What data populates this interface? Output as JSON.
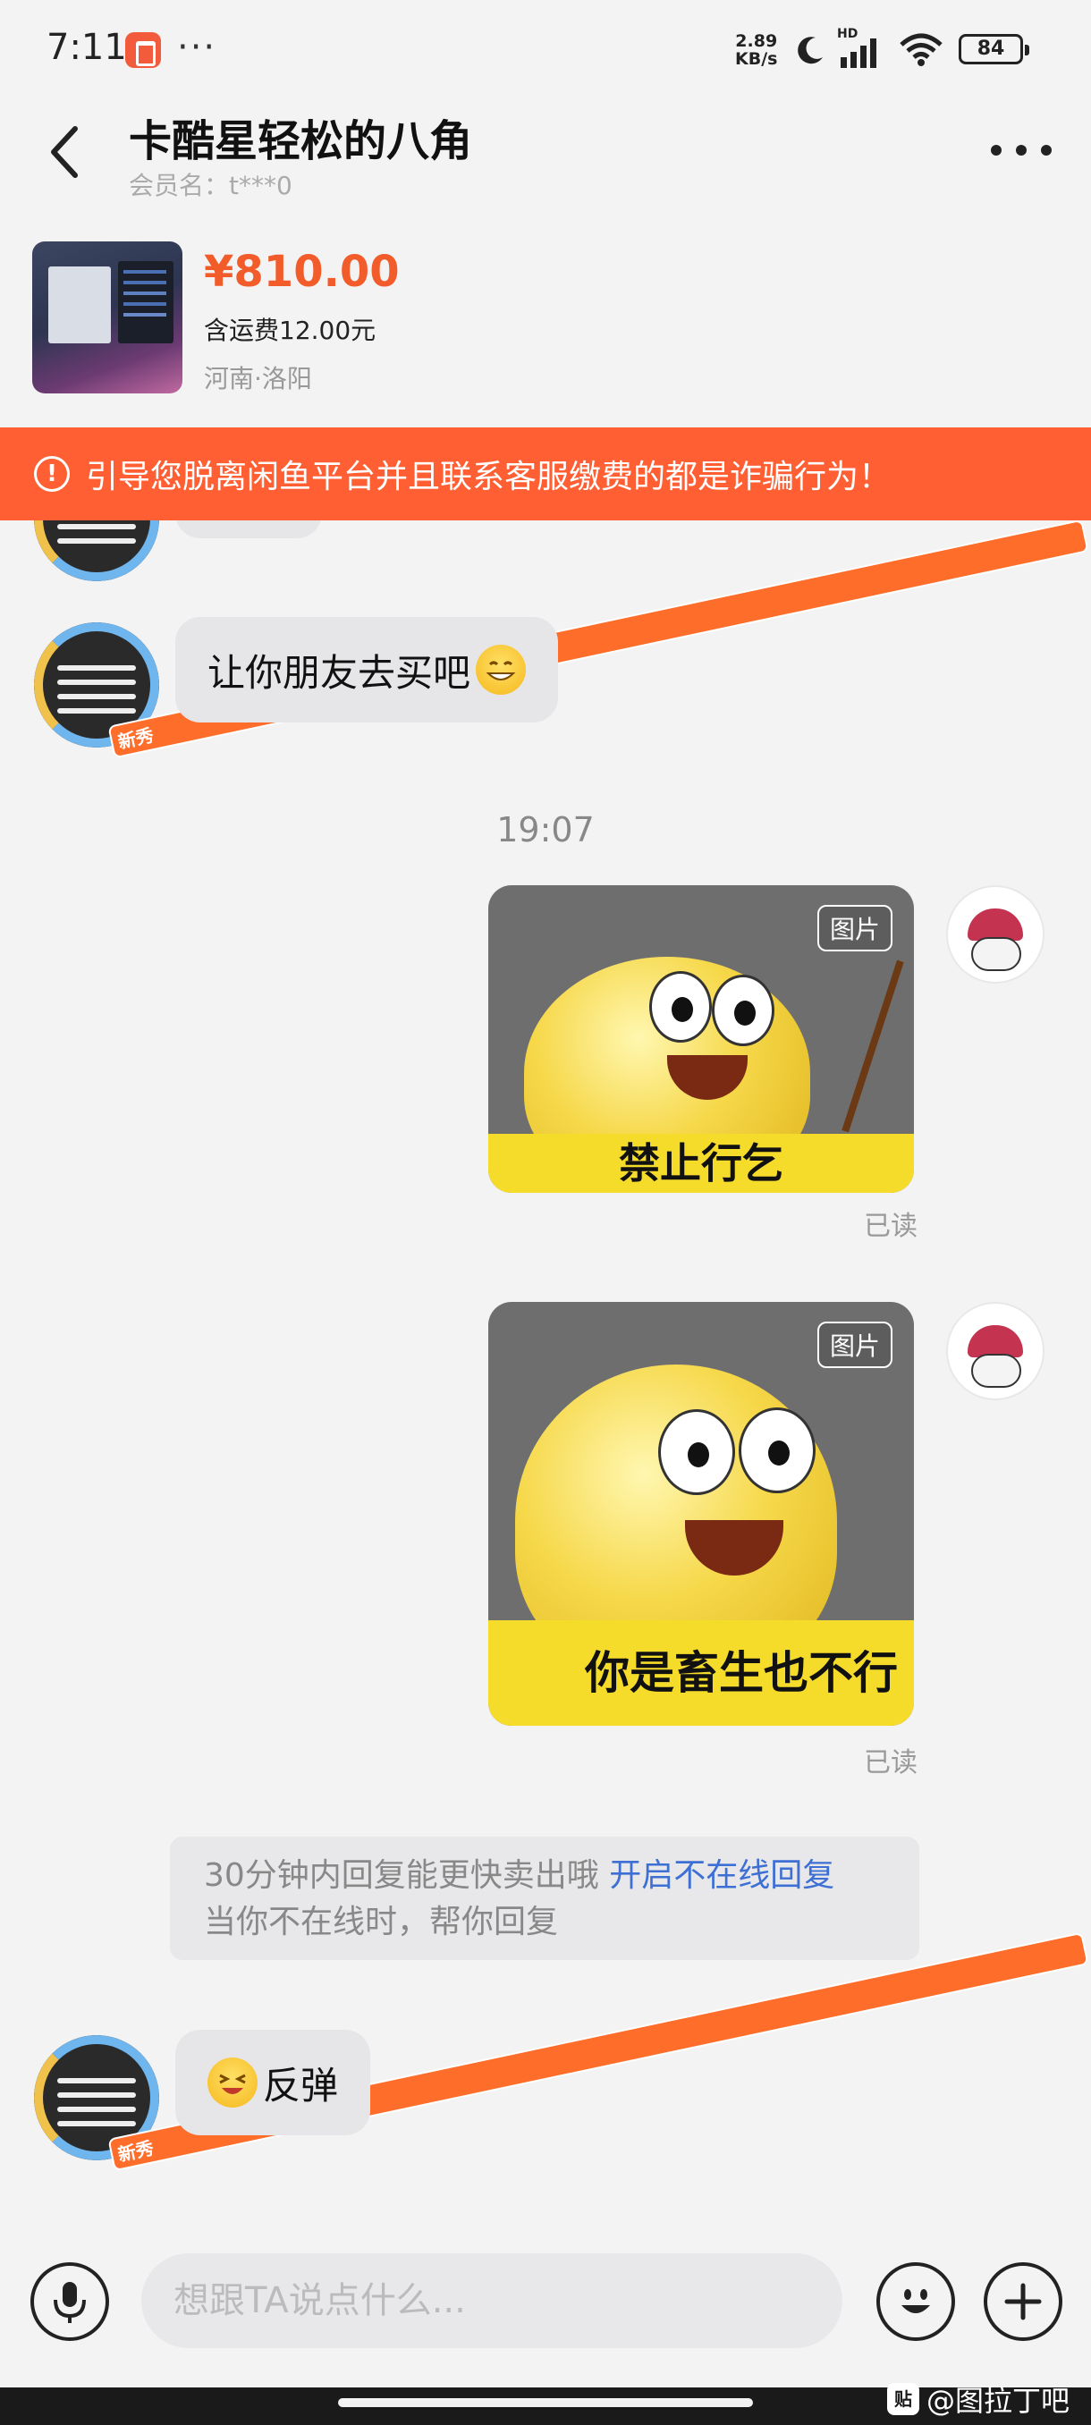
{
  "status_bar": {
    "time": "7:11",
    "more": "···",
    "net_speed_value": "2.89",
    "net_speed_unit": "KB/s",
    "hd": "HD",
    "battery": "84"
  },
  "header": {
    "title": "卡酷星轻松的八角",
    "member_name": "会员名：t***0"
  },
  "product": {
    "price": "¥810.00",
    "shipping": "含运费12.00元",
    "location": "河南·洛阳"
  },
  "warning": {
    "icon": "!",
    "text": "引导您脱离闲鱼平台并且联系客服缴费的都是诈骗行为！"
  },
  "messages": {
    "msg1_text": "让你朋友去买吧",
    "timestamp": "19:07",
    "sticker1": {
      "tag": "图片",
      "caption": "禁止行乞",
      "read": "已读"
    },
    "sticker2": {
      "tag": "图片",
      "caption": "你是畜生也不行",
      "read": "已读"
    },
    "auto_reply": {
      "line1": "30分钟内回复能更快卖出哦",
      "link": "开启不在线回复",
      "line2": "当你不在线时，帮你回复"
    },
    "msg2_text": "反弹",
    "new_badge": "新秀"
  },
  "input": {
    "placeholder": "想跟TA说点什么..."
  },
  "watermark": {
    "text": "@图拉丁吧",
    "logo": "贴"
  },
  "colors": {
    "accent_orange": "#ff5f33",
    "price": "#f25b2a",
    "link_blue": "#3d6fd4"
  }
}
